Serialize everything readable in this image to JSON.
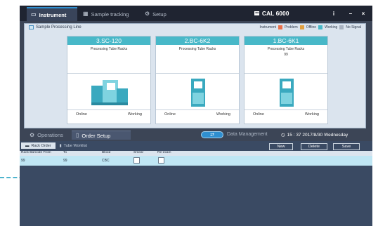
{
  "title_bar": {
    "tabs": [
      {
        "label": "Instrument",
        "icon": "monitor-icon"
      },
      {
        "label": "Sample tracking",
        "icon": "tracking-icon"
      },
      {
        "label": "Setup",
        "icon": "gear-icon"
      }
    ],
    "system_name": "CAL 6000",
    "info_label": "i",
    "minimize_label": "–",
    "close_label": "×"
  },
  "processing_line": {
    "title": "Sample Processing Line",
    "legend": [
      {
        "label": "Instrument",
        "color": "#e8704a"
      },
      {
        "label": "Problem",
        "color": "#e8a23a"
      },
      {
        "label": "Offline",
        "color": "#e0a040"
      },
      {
        "label": "Working",
        "color": "#48b8c8"
      },
      {
        "label": "No Signal",
        "color": "#a8b2c0"
      }
    ],
    "instruments": [
      {
        "name": "3.SC-120",
        "subtitle": "Processing Tube Racks",
        "count": "",
        "status_left": "Online",
        "status_right": "Working"
      },
      {
        "name": "2.BC-6K2",
        "subtitle": "Processing Tube Racks",
        "count": "",
        "status_left": "Online",
        "status_right": "Working"
      },
      {
        "name": "1.BC-6K1",
        "subtitle": "Processing Tube Racks",
        "count": "99",
        "status_left": "Online",
        "status_right": "Working"
      }
    ]
  },
  "lower_bar": {
    "operations_label": "Operations",
    "order_setup_label": "Order Setup",
    "data_management_label": "Data Management",
    "clock": "15 : 37  2017/8/30  Wednesday"
  },
  "order_setup": {
    "subtabs": [
      "Rack Order",
      "Tube Worklist"
    ],
    "buttons": {
      "new": "New",
      "delete": "Delete",
      "save": "Save"
    },
    "columns": [
      "Rack Barcode From",
      "To",
      "Blood",
      "Smear",
      "Re-exam"
    ],
    "rows": [
      {
        "from": "99",
        "to": "99",
        "blood": "CBC"
      }
    ]
  },
  "colors": {
    "accent": "#48b8c8",
    "app_bg": "#3c4556",
    "panel_bg": "#dbe4ee",
    "selected_row": "#bfe6f4"
  }
}
